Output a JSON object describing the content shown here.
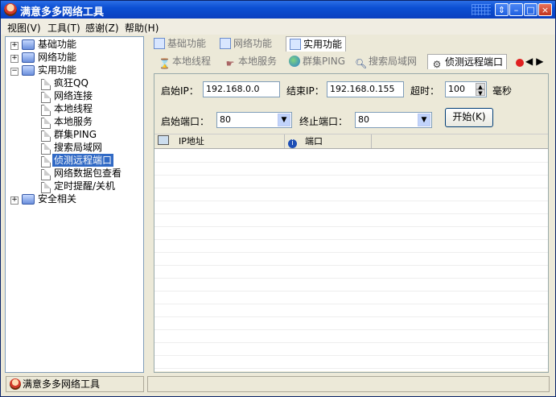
{
  "window": {
    "title": "满意多多网络工具"
  },
  "menu": [
    {
      "label": "视图(V)"
    },
    {
      "label": "工具(T)"
    },
    {
      "label": "感谢(Z)"
    },
    {
      "label": "帮助(H)"
    }
  ],
  "tree": {
    "nodes": [
      {
        "label": "基础功能",
        "type": "folder"
      },
      {
        "label": "网络功能",
        "type": "folder"
      },
      {
        "label": "实用功能",
        "type": "folder"
      },
      {
        "label": "疯狂QQ",
        "type": "leaf"
      },
      {
        "label": "网络连接",
        "type": "leaf"
      },
      {
        "label": "本地线程",
        "type": "leaf"
      },
      {
        "label": "本地服务",
        "type": "leaf"
      },
      {
        "label": "群集PING",
        "type": "leaf"
      },
      {
        "label": "搜索局域网",
        "type": "leaf"
      },
      {
        "label": "侦测远程端口",
        "type": "leaf",
        "selected": true
      },
      {
        "label": "网络数据包查看",
        "type": "leaf"
      },
      {
        "label": "定时提醒/关机",
        "type": "leaf"
      },
      {
        "label": "安全相关",
        "type": "folder"
      }
    ]
  },
  "tabs_primary": [
    {
      "label": "基础功能"
    },
    {
      "label": "网络功能"
    },
    {
      "label": "实用功能",
      "active": true
    }
  ],
  "tabs_secondary": [
    {
      "label": "本地线程"
    },
    {
      "label": "本地服务"
    },
    {
      "label": "群集PING"
    },
    {
      "label": "搜索局域网"
    },
    {
      "label": "侦测远程端口",
      "active": true
    }
  ],
  "form": {
    "start_ip_label": "启始IP：",
    "start_ip_value": "192.168.0.0",
    "end_ip_label": "结束IP：",
    "end_ip_value": "192.168.0.155",
    "timeout_label": "超时：",
    "timeout_value": "100",
    "timeout_unit": "毫秒",
    "start_port_label": "启始端口：",
    "start_port_value": "80",
    "end_port_label": "终止端口：",
    "end_port_value": "80",
    "start_button": "开始(K)"
  },
  "list": {
    "columns": [
      {
        "label": "IP地址"
      },
      {
        "label": "端口"
      }
    ]
  },
  "status": {
    "text": "满意多多网络工具"
  }
}
